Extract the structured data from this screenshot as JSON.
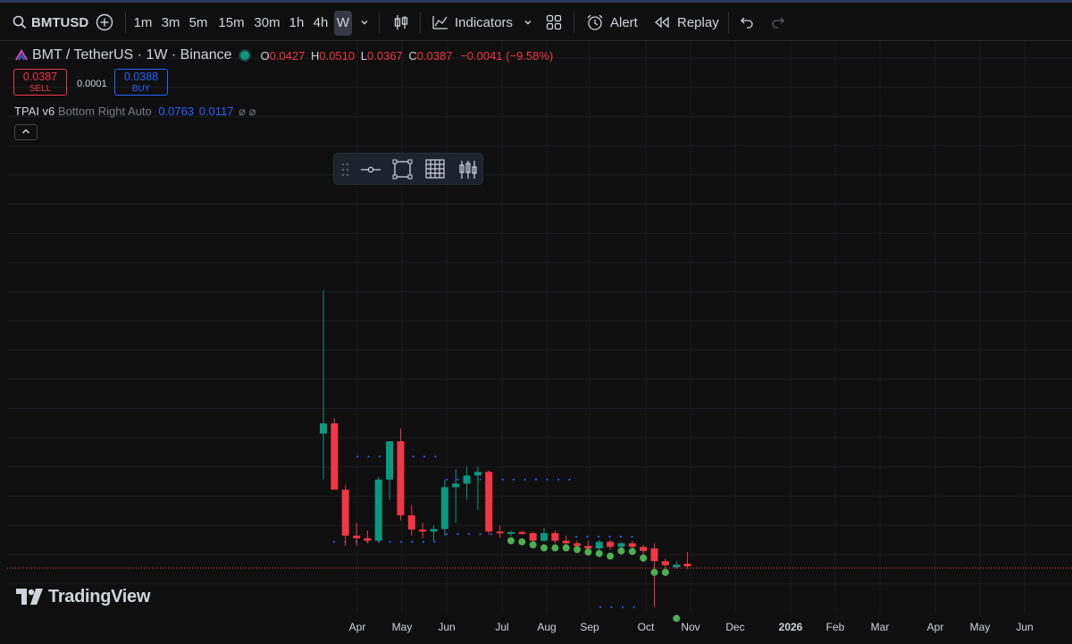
{
  "toolbar": {
    "symbol": "BMTUSD",
    "timeframes": [
      "1m",
      "3m",
      "5m",
      "15m",
      "30m",
      "1h",
      "4h",
      "W"
    ],
    "active_timeframe": "W",
    "indicators_label": "Indicators",
    "alert_label": "Alert",
    "replay_label": "Replay"
  },
  "legend": {
    "title": "BMT / TetherUS · 1W · Binance",
    "open_key": "O",
    "open": "0.0427",
    "high_key": "H",
    "high": "0.0510",
    "low_key": "L",
    "low": "0.0367",
    "close_key": "C",
    "close": "0.0387",
    "change": "−0.0041 (−9.58%)",
    "sell_price": "0.0387",
    "sell_label": "SELL",
    "spread": "0.0001",
    "buy_price": "0.0388",
    "buy_label": "BUY"
  },
  "indicator": {
    "name": "TPAI v6",
    "params": "Bottom Right Auto",
    "value1": "0.0763",
    "value2": "0.0117",
    "collapse_icon": "chevron-up-icon"
  },
  "x_axis": {
    "labels": [
      "Apr",
      "May",
      "Jun",
      "Jul",
      "Aug",
      "Sep",
      "Oct",
      "Nov",
      "Dec",
      "2026",
      "Feb",
      "Mar",
      "Apr",
      "May",
      "Jun"
    ]
  },
  "branding": {
    "logo_text": "TradingView"
  },
  "colors": {
    "up": "#089981",
    "down": "#f23645",
    "dots": "#2962ff",
    "signal": "#4caf50",
    "price_line": "#f23645"
  },
  "chart_data": {
    "type": "candlestick",
    "series_interval": "1W",
    "candles": [
      {
        "o": 0.057,
        "h": 0.085,
        "l": 0.048,
        "c": 0.059
      },
      {
        "o": 0.059,
        "h": 0.06,
        "l": 0.047,
        "c": 0.046
      },
      {
        "o": 0.046,
        "h": 0.047,
        "l": 0.035,
        "c": 0.037
      },
      {
        "o": 0.037,
        "h": 0.0395,
        "l": 0.035,
        "c": 0.0365
      },
      {
        "o": 0.0365,
        "h": 0.038,
        "l": 0.0355,
        "c": 0.036
      },
      {
        "o": 0.036,
        "h": 0.0485,
        "l": 0.0358,
        "c": 0.048
      },
      {
        "o": 0.048,
        "h": 0.0545,
        "l": 0.044,
        "c": 0.0555
      },
      {
        "o": 0.0555,
        "h": 0.058,
        "l": 0.04,
        "c": 0.041
      },
      {
        "o": 0.041,
        "h": 0.043,
        "l": 0.037,
        "c": 0.0382
      },
      {
        "o": 0.0382,
        "h": 0.0395,
        "l": 0.0365,
        "c": 0.0378
      },
      {
        "o": 0.0378,
        "h": 0.039,
        "l": 0.036,
        "c": 0.0383
      },
      {
        "o": 0.0383,
        "h": 0.048,
        "l": 0.037,
        "c": 0.0465
      },
      {
        "o": 0.0465,
        "h": 0.05,
        "l": 0.0395,
        "c": 0.0472
      },
      {
        "o": 0.0472,
        "h": 0.0505,
        "l": 0.044,
        "c": 0.0488
      },
      {
        "o": 0.0488,
        "h": 0.0505,
        "l": 0.042,
        "c": 0.0495
      },
      {
        "o": 0.0495,
        "h": 0.0498,
        "l": 0.0372,
        "c": 0.0378
      },
      {
        "o": 0.0378,
        "h": 0.039,
        "l": 0.0365,
        "c": 0.0375
      },
      {
        "o": 0.0375,
        "h": 0.038,
        "l": 0.037,
        "c": 0.0377
      },
      {
        "o": 0.0377,
        "h": 0.038,
        "l": 0.0372,
        "c": 0.0375
      },
      {
        "o": 0.0375,
        "h": 0.0378,
        "l": 0.0355,
        "c": 0.036
      },
      {
        "o": 0.036,
        "h": 0.0385,
        "l": 0.0358,
        "c": 0.0375
      },
      {
        "o": 0.0375,
        "h": 0.038,
        "l": 0.0355,
        "c": 0.036
      },
      {
        "o": 0.036,
        "h": 0.037,
        "l": 0.0348,
        "c": 0.0355
      },
      {
        "o": 0.0355,
        "h": 0.036,
        "l": 0.0345,
        "c": 0.035
      },
      {
        "o": 0.035,
        "h": 0.036,
        "l": 0.034,
        "c": 0.0345
      },
      {
        "o": 0.0345,
        "h": 0.0362,
        "l": 0.034,
        "c": 0.0358
      },
      {
        "o": 0.0358,
        "h": 0.0362,
        "l": 0.0342,
        "c": 0.0348
      },
      {
        "o": 0.0348,
        "h": 0.0358,
        "l": 0.0338,
        "c": 0.0355
      },
      {
        "o": 0.0355,
        "h": 0.036,
        "l": 0.034,
        "c": 0.0348
      },
      {
        "o": 0.0348,
        "h": 0.0352,
        "l": 0.0328,
        "c": 0.034
      },
      {
        "o": 0.0345,
        "h": 0.0355,
        "l": 0.023,
        "c": 0.032
      },
      {
        "o": 0.032,
        "h": 0.0325,
        "l": 0.0305,
        "c": 0.0312
      },
      {
        "o": 0.0308,
        "h": 0.032,
        "l": 0.0305,
        "c": 0.0313
      },
      {
        "o": 0.0315,
        "h": 0.0338,
        "l": 0.0305,
        "c": 0.031
      }
    ],
    "signal_dots": [
      0.036,
      0.0358,
      0.0352,
      0.0346,
      0.0346,
      0.0346,
      0.0343,
      0.0338,
      0.0335,
      0.033,
      0.034,
      0.0339,
      0.0326,
      0.0298,
      0.0298,
      0.0208
    ],
    "last_price": 0.031
  }
}
